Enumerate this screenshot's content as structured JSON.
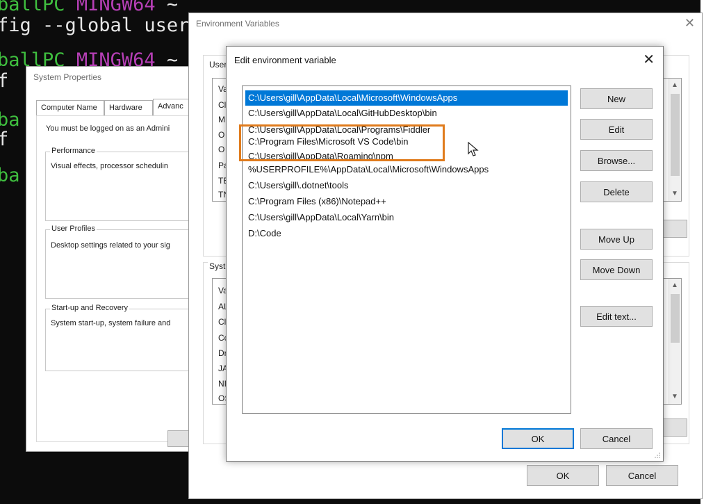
{
  "terminal": {
    "lines": [
      {
        "prompt_user": "ballPC",
        "prompt_env": "MINGW64",
        "prompt_tail": " ~"
      },
      {
        "command": "fig --global user"
      },
      {
        "prompt_user": "ballPC",
        "prompt_env": "MINGW64",
        "prompt_tail": " ~"
      },
      {
        "command": "f"
      },
      {
        "prompt_user": "ba",
        "prompt_env": "",
        "prompt_tail": ""
      },
      {
        "command": "f"
      },
      {
        "prompt_user": "ba",
        "prompt_env": "",
        "prompt_tail": ""
      }
    ]
  },
  "system_properties": {
    "title": "System Properties",
    "tabs": [
      "Computer Name",
      "Hardware",
      "Advanc"
    ],
    "admin_note": "You must be logged on as an Admini",
    "groups": [
      {
        "label": "Performance",
        "desc": "Visual effects, processor schedulin"
      },
      {
        "label": "User Profiles",
        "desc": "Desktop settings related to your sig"
      },
      {
        "label": "Start-up and Recovery",
        "desc": "System start-up, system failure and"
      }
    ]
  },
  "environment_variables": {
    "title": "Environment Variables",
    "user_label": "User",
    "user_vars": [
      "Va",
      "Cl",
      "M",
      "O",
      "O",
      "Pa",
      "TE",
      "TN"
    ],
    "system_label": "Syst",
    "system_vars": [
      "Va",
      "AL",
      "Cl",
      "Co",
      "Dr",
      "JA",
      "NI",
      "OS"
    ],
    "ok_label": "OK",
    "cancel_label": "Cancel"
  },
  "edit_variable": {
    "title": "Edit environment variable",
    "close_glyph": "✕",
    "paths": [
      "C:\\Users\\gill\\AppData\\Local\\Microsoft\\WindowsApps",
      "C:\\Users\\gill\\AppData\\Local\\GitHubDesktop\\bin",
      "C:\\Users\\gill\\AppData\\Local\\Programs\\Fiddler",
      "C:\\Program Files\\Microsoft VS Code\\bin",
      "C:\\Users\\gill\\AppData\\Roaming\\npm",
      "%USERPROFILE%\\AppData\\Local\\Microsoft\\WindowsApps",
      "C:\\Users\\gill\\.dotnet\\tools",
      "C:\\Program Files (x86)\\Notepad++",
      "C:\\Users\\gill\\AppData\\Local\\Yarn\\bin",
      "D:\\Code"
    ],
    "selected_index": 0,
    "buttons": {
      "new": "New",
      "edit": "Edit",
      "browse": "Browse...",
      "delete": "Delete",
      "move_up": "Move Up",
      "move_down": "Move Down",
      "edit_text": "Edit text...",
      "ok": "OK",
      "cancel": "Cancel"
    }
  },
  "colors": {
    "selection": "#0078d7",
    "highlight_box": "#e07b1c",
    "terminal_bg": "#0c0c0c",
    "prompt_green": "#3fbf3f",
    "prompt_magenta": "#b63fb6"
  }
}
